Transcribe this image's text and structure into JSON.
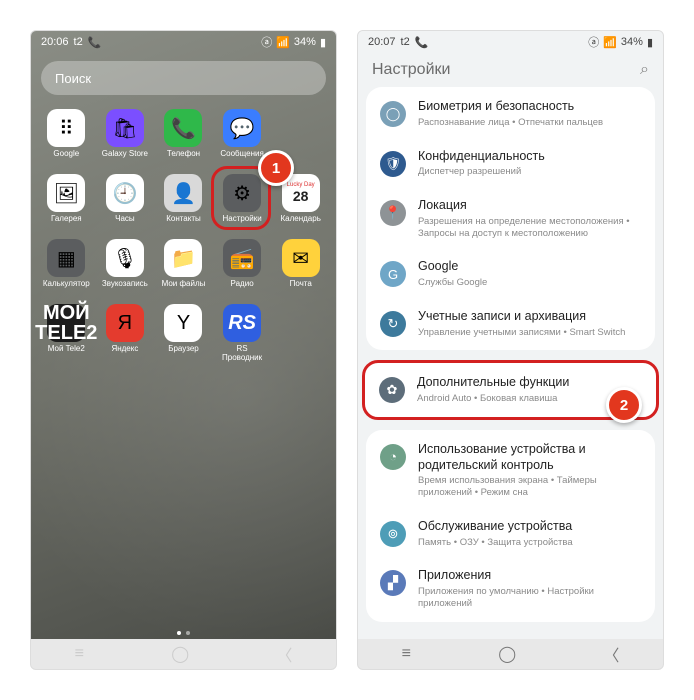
{
  "status": {
    "time_left": "20:06",
    "time_right": "20:07",
    "extra": "t2",
    "battery": "34%",
    "icons": [
      "📞",
      "ⓐ",
      "📶",
      "🔋"
    ]
  },
  "search_placeholder": "Поиск",
  "home_apps": [
    {
      "label": "Google",
      "icon": "⠿",
      "bg": "ic-white"
    },
    {
      "label": "Galaxy Store",
      "icon": "🛍",
      "bg": "ic-purple"
    },
    {
      "label": "Телефон",
      "icon": "📞",
      "bg": "ic-green"
    },
    {
      "label": "Сообщения",
      "icon": "💬",
      "bg": "ic-blue"
    },
    {
      "label": "",
      "icon": "",
      "bg": ""
    },
    {
      "label": "Галерея",
      "icon": "🖼",
      "bg": "ic-white"
    },
    {
      "label": "Часы",
      "icon": "🕘",
      "bg": "ic-white"
    },
    {
      "label": "Контакты",
      "icon": "👤",
      "bg": "ic-grey"
    },
    {
      "label": "Настройки",
      "icon": "⚙",
      "bg": "ic-dgrey",
      "hl": true
    },
    {
      "label": "Календарь",
      "icon": "28",
      "bg": "ic-white",
      "cal": true
    },
    {
      "label": "Калькулятор",
      "icon": "▦",
      "bg": "ic-dgrey"
    },
    {
      "label": "Звукозапись",
      "icon": "🎙",
      "bg": "ic-white"
    },
    {
      "label": "Мои файлы",
      "icon": "📁",
      "bg": "ic-white"
    },
    {
      "label": "Радио",
      "icon": "📻",
      "bg": "ic-dgrey"
    },
    {
      "label": "Почта",
      "icon": "✉",
      "bg": "ic-yellow"
    },
    {
      "label": "Мой Tele2",
      "icon": "МОЙ\\nTELE2",
      "bg": "ic-black"
    },
    {
      "label": "Яндекс",
      "icon": "Я",
      "bg": "ic-red"
    },
    {
      "label": "Браузер",
      "icon": "Y",
      "bg": "ic-white"
    },
    {
      "label": "RS\\nПроводник",
      "icon": "RS",
      "bg": "ic-rsblue"
    },
    {
      "label": "",
      "icon": "",
      "bg": ""
    }
  ],
  "callout1": "1",
  "callout2": "2",
  "settings_title": "Настройки",
  "settings_groups": [
    [
      {
        "title": "Биометрия и безопасность",
        "sub": "Распознавание лица • Отпечатки пальцев",
        "color": "#7aa0b7",
        "glyph": "◯"
      },
      {
        "title": "Конфиденциальность",
        "sub": "Диспетчер разрешений",
        "color": "#2e5a8f",
        "glyph": "🛡"
      },
      {
        "title": "Локация",
        "sub": "Разрешения на определение местоположения • Запросы на доступ к местоположению",
        "color": "#8e9396",
        "glyph": "📍"
      },
      {
        "title": "Google",
        "sub": "Службы Google",
        "color": "#6fa6c7",
        "glyph": "G"
      },
      {
        "title": "Учетные записи и архивация",
        "sub": "Управление учетными записями • Smart Switch",
        "color": "#3d7a9c",
        "glyph": "↻"
      }
    ],
    [
      {
        "title": "Дополнительные функции",
        "sub": "Android Auto • Боковая клавиша",
        "color": "#5d6d7a",
        "glyph": "✿",
        "hl": true
      }
    ],
    [
      {
        "title": "Использование устройства и родительский контроль",
        "sub": "Время использования экрана • Таймеры приложений • Режим сна",
        "color": "#6fa088",
        "glyph": "◔"
      },
      {
        "title": "Обслуживание устройства",
        "sub": "Память • ОЗУ • Защита устройства",
        "color": "#4e9db7",
        "glyph": "⊚"
      },
      {
        "title": "Приложения",
        "sub": "Приложения по умолчанию • Настройки приложений",
        "color": "#5a7ab9",
        "glyph": "▞"
      }
    ]
  ]
}
